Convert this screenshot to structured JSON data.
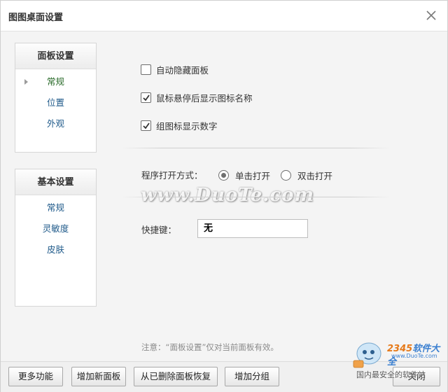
{
  "window": {
    "title": "图图桌面设置"
  },
  "panel_settings": {
    "heading": "面板设置",
    "items": [
      {
        "label": "常规",
        "active": true
      },
      {
        "label": "位置",
        "active": false
      },
      {
        "label": "外观",
        "active": false
      }
    ]
  },
  "basic_settings": {
    "heading": "基本设置",
    "items": [
      {
        "label": "常规"
      },
      {
        "label": "灵敏度"
      },
      {
        "label": "皮肤"
      }
    ]
  },
  "options": {
    "auto_hide": {
      "label": "自动隐藏面板",
      "checked": false
    },
    "hover_name": {
      "label": "鼠标悬停后显示图标名称",
      "checked": true
    },
    "group_count": {
      "label": "组图标显示数字",
      "checked": true
    }
  },
  "open_mode": {
    "label": "程序打开方式：",
    "choices": [
      {
        "label": "单击打开",
        "selected": true
      },
      {
        "label": "双击打开",
        "selected": false
      }
    ]
  },
  "hotkey": {
    "label": "快捷键：",
    "value": "无"
  },
  "note": "注意：“面板设置”仅对当前面板有效。",
  "watermark": "www.DuoTe.com",
  "footer_buttons": {
    "more": "更多功能",
    "add_panel": "增加新面板",
    "restore": "从已删除面板恢复",
    "add_group": "增加分组",
    "close": "关闭"
  },
  "overlay_logo": {
    "brand_digits": "2345",
    "brand_text": "软件大全",
    "url": "www.DuoTe.com",
    "slogan": "国内最安全的软件站"
  },
  "icons": [
    "close-icon",
    "checkbox-icon",
    "radio-icon",
    "arrow-right-icon",
    "mascot-icon"
  ],
  "colors": {
    "nav_link": "#1f5a8a",
    "nav_active": "#2a6b2a",
    "brand_blue": "#3a7fd0",
    "brand_orange": "#e67a1a"
  }
}
